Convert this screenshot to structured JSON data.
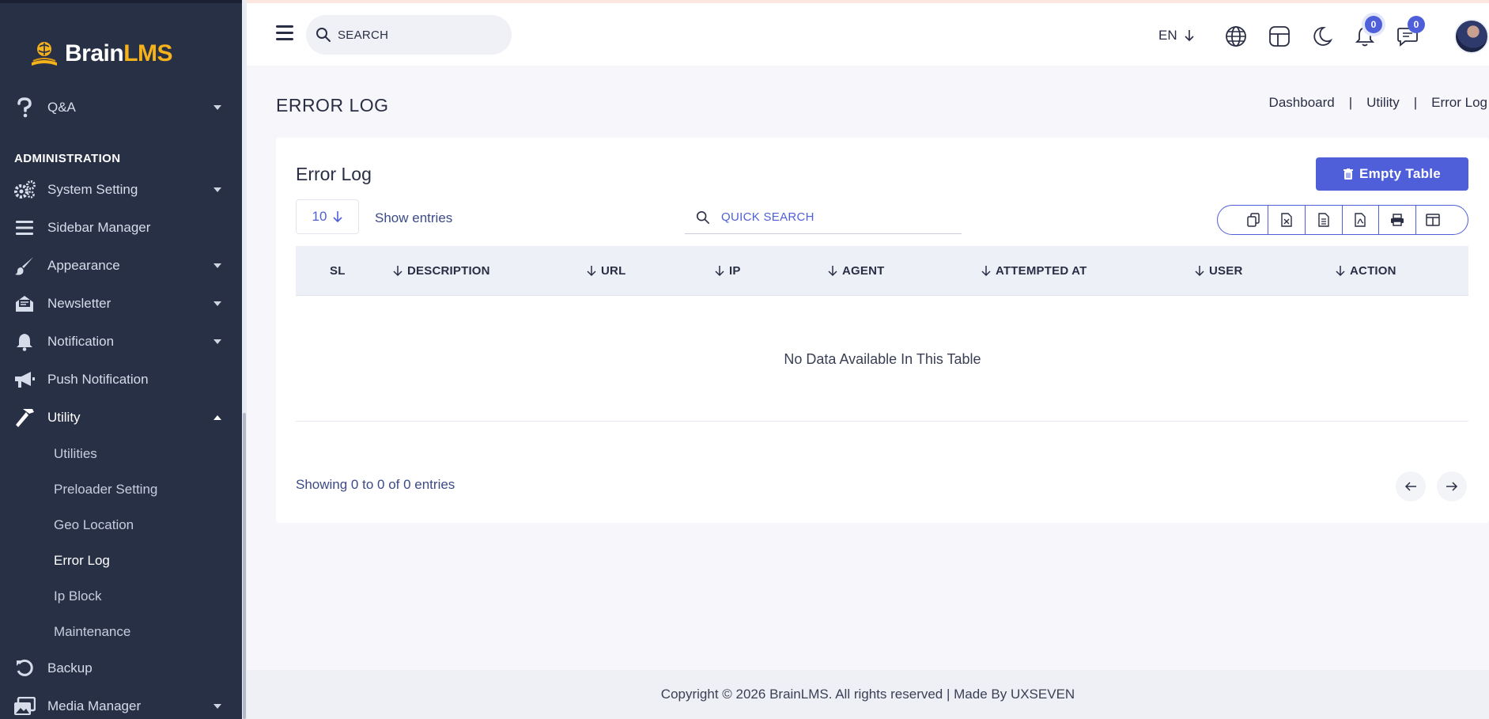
{
  "brand": {
    "name_part1": "Brain",
    "name_part2": "LMS",
    "accent_color": "#f6b21b"
  },
  "sidebar": {
    "top_item": {
      "label": "Q&A",
      "icon": "question-icon"
    },
    "section_title": "ADMINISTRATION",
    "items": [
      {
        "label": "System Setting",
        "icon": "gears-icon",
        "has_caret": true
      },
      {
        "label": "Sidebar Manager",
        "icon": "bars-icon",
        "has_caret": false
      },
      {
        "label": "Appearance",
        "icon": "brush-icon",
        "has_caret": true
      },
      {
        "label": "Newsletter",
        "icon": "envelope-open-icon",
        "has_caret": true
      },
      {
        "label": "Notification",
        "icon": "bell-icon",
        "has_caret": true
      },
      {
        "label": "Push Notification",
        "icon": "megaphone-icon",
        "has_caret": false
      },
      {
        "label": "Utility",
        "icon": "hammer-icon",
        "has_caret": true,
        "expanded": true
      }
    ],
    "utility_sub": [
      "Utilities",
      "Preloader Setting",
      "Geo Location",
      "Error Log",
      "Ip Block",
      "Maintenance"
    ],
    "active_sub": "Error Log",
    "bottom_items": [
      {
        "label": "Backup",
        "icon": "undo-icon"
      },
      {
        "label": "Media Manager",
        "icon": "images-icon"
      }
    ]
  },
  "topbar": {
    "search_placeholder": "SEARCH",
    "language": "EN",
    "notifications_count": "0",
    "messages_count": "0"
  },
  "page": {
    "title": "ERROR LOG",
    "breadcrumb": [
      "Dashboard",
      "Utility",
      "Error Log"
    ]
  },
  "card": {
    "title": "Error Log",
    "empty_button_label": "Empty Table",
    "entries_value": "10",
    "show_entries_label": "Show entries",
    "quick_search_placeholder": "QUICK SEARCH",
    "columns": [
      "SL",
      "DESCRIPTION",
      "URL",
      "IP",
      "AGENT",
      "ATTEMPTED AT",
      "USER",
      "ACTION"
    ],
    "rows": [],
    "empty_message": "No Data Available In This Table",
    "showing_text": "Showing 0 to 0 of 0 entries",
    "export_buttons": [
      "copy-icon",
      "excel-icon",
      "csv-icon",
      "pdf-icon",
      "print-icon",
      "columns-icon"
    ]
  },
  "footer": {
    "text": "Copyright © 2026 BrainLMS. All rights reserved | Made By UXSEVEN"
  },
  "colors": {
    "primary": "#4f5fd9",
    "sidebar_bg": "#283046"
  }
}
